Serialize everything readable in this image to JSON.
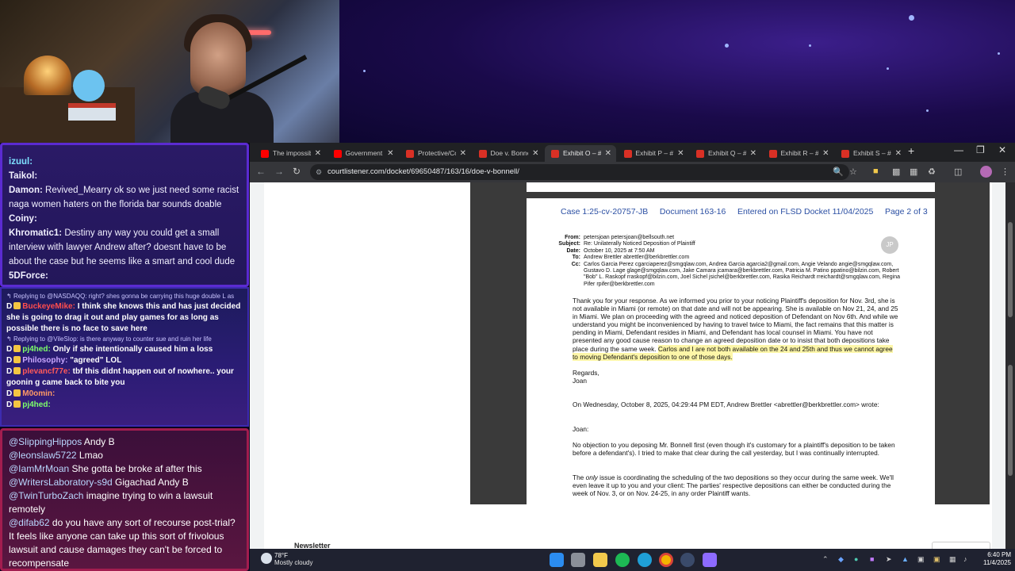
{
  "chat_main": [
    {
      "user": "izuul:",
      "text": "",
      "user_color": "#7ee0ff"
    },
    {
      "user": "Taikol:",
      "text": "",
      "user_color": "#f1f0ff"
    },
    {
      "user": "Damon:",
      "text": "Revived_Mearry ok so we just need some racist naga women haters on the florida bar sounds doable",
      "user_color": "#f1f0ff"
    },
    {
      "user": "Coiny:",
      "text": "",
      "user_color": "#f1f0ff"
    },
    {
      "user": "Khromatic1:",
      "text": "Destiny any way you could get a small interview with lawyer Andrew after? doesnt have to be about the case but he seems like a smart and cool dude",
      "user_color": "#f1f0ff"
    },
    {
      "user": "5DForce:",
      "text": "",
      "user_color": "#f1f0ff"
    }
  ],
  "chat_mid": [
    {
      "reply": "Replying to @NASDAQQ: right? shes gonna be carrying this huge double L as",
      "user": "BuckeyeMike:",
      "user_color": "#ff4d4d",
      "text": "I think she knows this and has just decided she is going to drag it out and play games for as long as possible there is no face to save here"
    },
    {
      "reply": "Replying to @VileSlop: is there anyway to counter sue and ruin her life",
      "user": "pj4hed:",
      "user_color": "#7dff6a",
      "text": "Only if she intentionally caused him a loss"
    },
    {
      "reply": "",
      "user": "Philosophy:",
      "user_color": "#c9a7ff",
      "text": "\"agreed\" LOL"
    },
    {
      "reply": "",
      "user": "plevancf77e:",
      "user_color": "#ff5a5a",
      "text": "tbf this didnt happen out of nowhere.. your goonin g came back to bite you"
    },
    {
      "reply": "",
      "user": "M0omin:",
      "user_color": "#ff9966",
      "text": ""
    },
    {
      "reply": "",
      "user": "pj4hed:",
      "user_color": "#7dff6a",
      "text": ""
    }
  ],
  "chat_bottom": [
    {
      "user": "@SlippingHippos",
      "text": "Andy B"
    },
    {
      "user": "@leonslaw5722",
      "text": "Lmao"
    },
    {
      "user": "@IamMrMoan",
      "text": "She gotta be broke af after this"
    },
    {
      "user": "@WritersLaboratory-s9d",
      "text": "Gigachad Andy B"
    },
    {
      "user": "@TwinTurboZach",
      "text": "imagine trying to win a lawsuit remotely"
    },
    {
      "user": "@difab62",
      "text": "do you have any sort of recourse post-trial? It feels like anyone can take up this sort of frivolous lawsuit and cause damages they can't be forced to recompensate"
    }
  ],
  "browser": {
    "tabs": [
      {
        "title": "The impossibl",
        "icon": "yt"
      },
      {
        "title": "Government I",
        "icon": "yt"
      },
      {
        "title": "Protective/Co",
        "icon": "pdf"
      },
      {
        "title": "Doe v. Bonne",
        "icon": "pdf"
      },
      {
        "title": "Exhibit O – #1",
        "icon": "pdf",
        "active": true
      },
      {
        "title": "Exhibit P – #1",
        "icon": "pdf"
      },
      {
        "title": "Exhibit Q – #1",
        "icon": "pdf"
      },
      {
        "title": "Exhibit R – #1",
        "icon": "pdf"
      },
      {
        "title": "Exhibit S – #1",
        "icon": "pdf"
      }
    ],
    "url": "courtlistener.com/docket/69650487/163/16/doe-v-bonnell/"
  },
  "document": {
    "header": "Case 1:25-cv-20757-JB     Document 163-16     Entered on FLSD Docket 11/04/2025     Page 2 of 3",
    "email_header": [
      {
        "k": "From:",
        "v": "petersjoan  petersjoan@bellsouth.net"
      },
      {
        "k": "Subject:",
        "v": "Re: Unilaterally Noticed Deposition of Plaintiff"
      },
      {
        "k": "Date:",
        "v": "October 10, 2025 at 7:50 AM"
      },
      {
        "k": "To:",
        "v": "Andrew Brettler abrettler@berkbrettler.com"
      },
      {
        "k": "Cc:",
        "v": "Carlos Garcia Perez cgarciaperez@smgqlaw.com, Andrea Garcia agarcia2@gmail.com, Angie Velando angie@smgqlaw.com, Gustavo D. Lage glage@smgqlaw.com, Jake Camara jcamara@berkbrettler.com, Patricia M. Patino ppatino@bilzin.com, Robert \"Bob\" L. Raskopf rraskopf@bilzin.com, Joel Sichel jsichel@berkbrettler.com, Rasika Reichardt rreichardt@smgqlaw.com, Regina Pifer rpifer@berkbrettler.com"
      }
    ],
    "avatar_initials": "JP",
    "para1_plain": "Thank you for your response. As we informed you prior to your noticing Plaintiff's deposition for Nov. 3rd, she is not available in Miami (or remote) on that date and will not be appearing. She is available on Nov 21, 24, and 25 in Miami. We plan on proceeding with the agreed and noticed deposition of Defendant on Nov 6th. And while we understand you might be inconvenienced by having to travel twice to Miami, the fact remains that this  matter is pending in Miami, Defendant resides in Miami, and Defendant has local counsel in Miami. You have not presented any good cause reason to change an agreed deposition date or to insist that both depositions take place during the same week. ",
    "para1_highlight": "Carlos and I are not both available on the 24 and 25th and thus we cannot agree to moving Defendant's deposition to one of those days.",
    "regards": "Regards,",
    "signoff": "Joan",
    "quote_intro": "On Wednesday, October 8, 2025, 04:29:44 PM EDT, Andrew Brettler <abrettler@berkbrettler.com> wrote:",
    "salutation": "Joan:",
    "para2": "No objection to you deposing Mr. Bonnell first (even though it's customary for a plaintiff's deposition to be taken before a defendant's). I tried to make that clear during the call yesterday, but I was continually interrupted.",
    "para3_pre": "The ",
    "para3_em": "only",
    "para3_post": " issue is coordinating the scheduling of the two depositions so they occur during the same week. We'll even leave it up to you and your client: The parties' respective depositions can either be conducted during the week of Nov. 3, or on Nov. 24-25, in any order Plaintiff wants."
  },
  "page_footer": {
    "newsletter": "Newsletter"
  },
  "taskbar": {
    "temperature": "78°F",
    "weather": "Mostly cloudy",
    "time": "6:40 PM",
    "date": "11/4/2025"
  },
  "colors": {
    "chat_main_border": "#5b2bd1",
    "chat_bottom_border": "#a21d4f",
    "doc_header_blue": "#2b4fa3",
    "highlight": "#fdf6a8"
  }
}
